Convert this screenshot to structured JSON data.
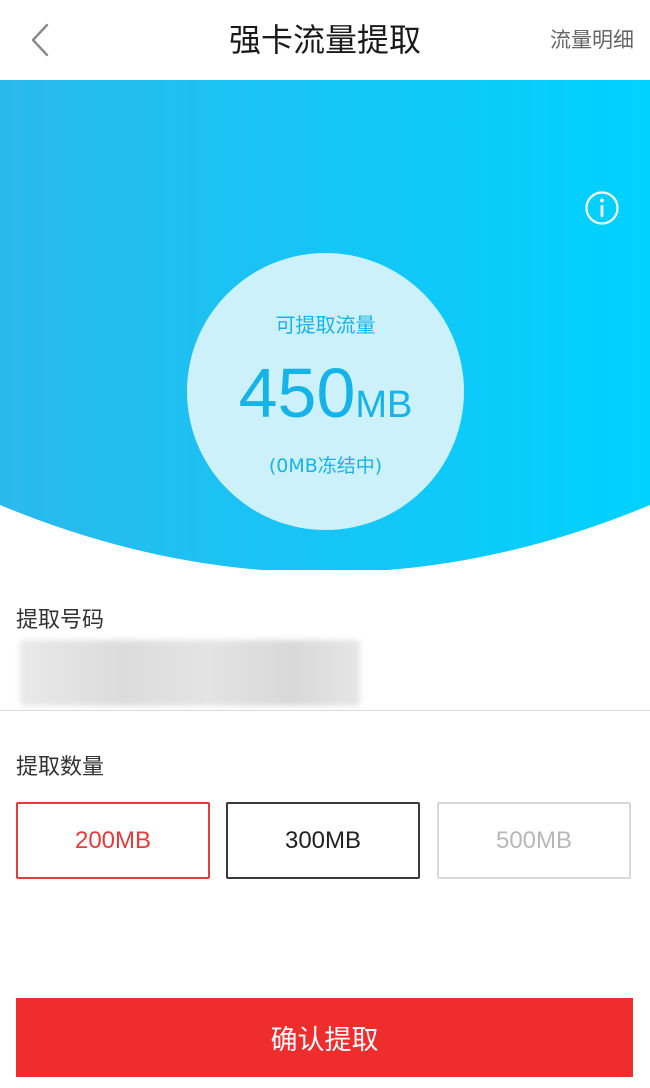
{
  "nav": {
    "title": "强卡流量提取",
    "detail_link": "流量明细",
    "back_icon": "chevron-left-icon"
  },
  "hero": {
    "label": "可提取流量",
    "amount": "450",
    "unit": "MB",
    "frozen_note": "(0MB冻结中)",
    "info_icon": "info-icon",
    "gradient_left": "#2bb9ec",
    "gradient_right": "#00d2ff"
  },
  "form": {
    "number_label": "提取号码",
    "quantity_label": "提取数量",
    "options": [
      {
        "label": "200MB",
        "state": "selected"
      },
      {
        "label": "300MB",
        "state": "normal"
      },
      {
        "label": "500MB",
        "state": "disabled"
      }
    ]
  },
  "confirm_button": "确认提取",
  "colors": {
    "accent_red": "#f02d2d",
    "hero_text": "#15b4e8"
  }
}
